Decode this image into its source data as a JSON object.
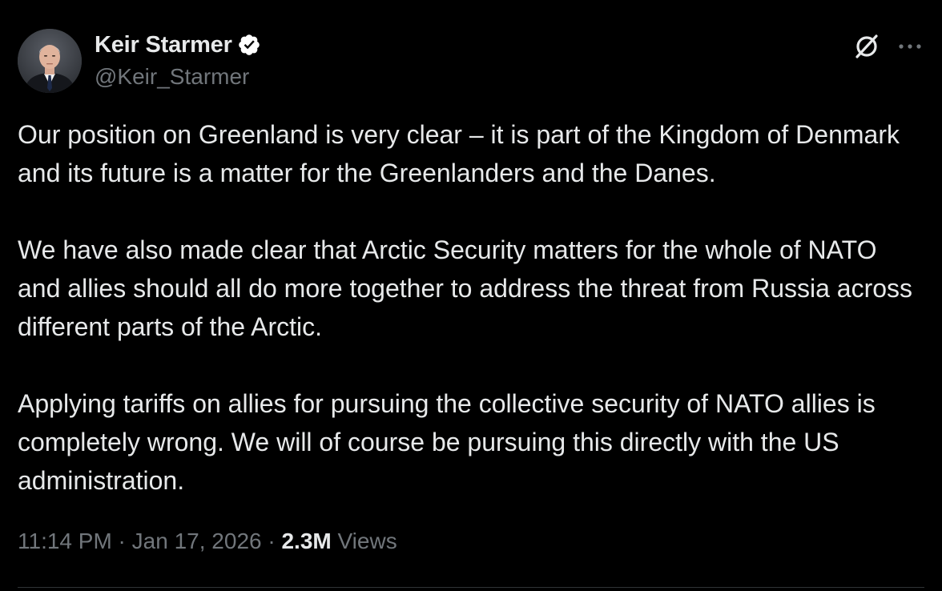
{
  "author": {
    "display_name": "Keir Starmer",
    "handle": "@Keir_Starmer",
    "verified": true,
    "avatar": "avatar-photo",
    "verified_badge_color": "#ffffff"
  },
  "actions": {
    "grok_icon": "grok-icon",
    "more_icon": "more-options-icon",
    "more_label": "···"
  },
  "tweet": {
    "paragraphs": [
      "Our position on Greenland is very clear – it is part of the Kingdom of Denmark and its future is a matter for the Greenlanders and the Danes.",
      "We have also made clear that Arctic Security matters for the whole of NATO and allies should all do more together to address the threat from Russia across different parts of the Arctic.",
      "Applying tariffs on allies for pursuing the collective security of NATO allies is completely wrong. We will of course be pursuing this directly with the US administration."
    ]
  },
  "meta": {
    "time": "11:14 PM",
    "date": "Jan 17, 2026",
    "separator": " · ",
    "views_count": "2.3M",
    "views_label": "Views"
  },
  "colors": {
    "background": "#000000",
    "text_primary": "#e7e9ea",
    "text_secondary": "#71767b",
    "divider": "#2f3336"
  }
}
